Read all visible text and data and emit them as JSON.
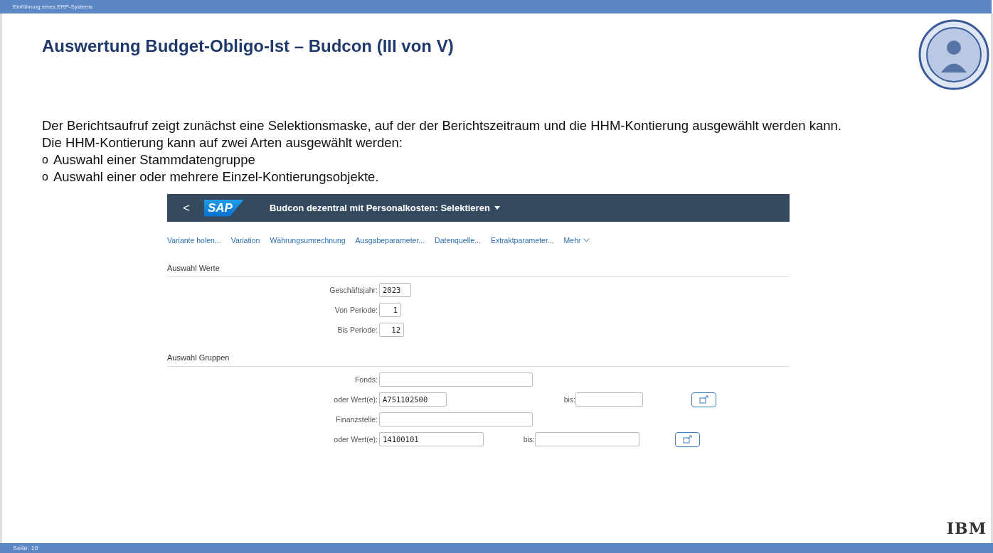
{
  "header": {
    "course": "Einführung eines ERP-Systems"
  },
  "slide": {
    "title": "Auswertung Budget-Obligo-Ist – Budcon (III von V)",
    "paragraphs": [
      "Der Berichtsaufruf zeigt zunächst eine Selektionsmaske, auf der der Berichtszeitraum und die HHM-Kontierung ausgewählt werden kann.",
      "Die HHM-Kontierung kann auf zwei Arten ausgewählt werden:"
    ],
    "bullets": [
      {
        "marker": "o",
        "text": "Auswahl einer Stammdatengruppe"
      },
      {
        "marker": "o",
        "text": "Auswahl einer oder mehrere Einzel-Kontierungsobjekte."
      }
    ]
  },
  "sap": {
    "back": "<",
    "logo": "SAP",
    "title": "Budcon dezentral mit Personalkosten: Selektieren",
    "toolbar": [
      {
        "label": "Variante holen..."
      },
      {
        "label": "Variation"
      },
      {
        "label": "Währungsumrechnung"
      },
      {
        "label": "Ausgabeparameter..."
      },
      {
        "label": "Datenquelle..."
      },
      {
        "label": "Extraktparameter..."
      },
      {
        "label": "Mehr",
        "kind": "menu"
      }
    ],
    "sections": [
      {
        "title": "Auswahl Werte",
        "rows": [
          {
            "kind": "single",
            "label": "Geschäftsjahr:",
            "value": "2023"
          },
          {
            "kind": "single",
            "label": "Von Periode:",
            "value": "1"
          },
          {
            "kind": "single",
            "label": "Bis Periode:",
            "value": "12"
          }
        ]
      },
      {
        "title": "Auswahl Gruppen",
        "rows": [
          {
            "kind": "single",
            "label": "Fonds:"
          },
          {
            "kind": "range",
            "label": "oder Wert(e):",
            "value": "A751102500",
            "to_label": "bis:"
          },
          {
            "kind": "single",
            "label": "Finanzstelle:"
          },
          {
            "kind": "range",
            "label": "oder Wert(e):",
            "value": "14100101",
            "to_label": "bis:"
          }
        ]
      }
    ]
  },
  "footer": {
    "page": "Seite: 10",
    "brand": "IBM"
  }
}
